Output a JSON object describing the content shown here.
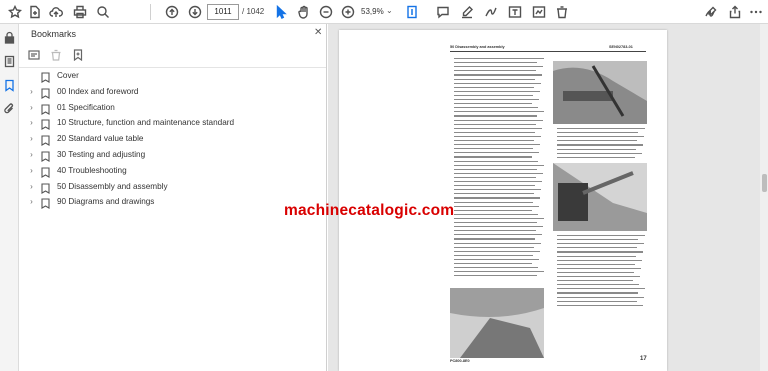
{
  "toolbar": {
    "current_page": "1011",
    "page_total": "/ 1042",
    "zoom": "53,9%"
  },
  "bookmarks_panel": {
    "title": "Bookmarks",
    "items": [
      {
        "label": "Cover",
        "expandable": false
      },
      {
        "label": "00 Index and foreword",
        "expandable": true
      },
      {
        "label": "01 Specification",
        "expandable": true
      },
      {
        "label": "10 Structure, function and maintenance standard",
        "expandable": true
      },
      {
        "label": "20 Standard value table",
        "expandable": true
      },
      {
        "label": "30 Testing and adjusting",
        "expandable": true
      },
      {
        "label": "40 Troubleshooting",
        "expandable": true
      },
      {
        "label": "50 Disassembly and assembly",
        "expandable": true
      },
      {
        "label": "90 Diagrams and drawings",
        "expandable": true
      }
    ]
  },
  "document": {
    "header_left": "50 Disassembly and assembly",
    "header_right": "SEN02783-01",
    "watermark": "machinecatalogic.com",
    "footer_left": "PC800-8E0",
    "footer_page": "17"
  },
  "colors": {
    "accent": "#1473e6",
    "watermark": "#d90000"
  }
}
